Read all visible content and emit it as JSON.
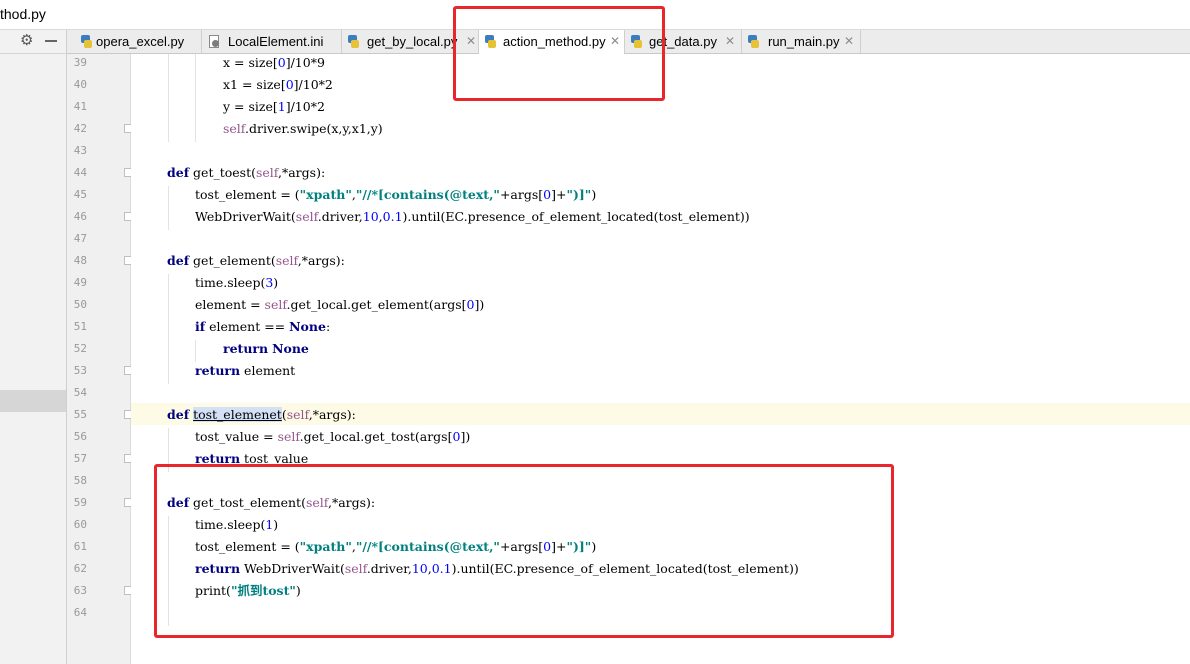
{
  "window": {
    "title": "thod.py"
  },
  "tabs": [
    {
      "label": "opera_excel.py",
      "icon": "python-file-icon"
    },
    {
      "label": "LocalElement.ini",
      "icon": "ini-file-icon"
    },
    {
      "label": "get_by_local.py",
      "icon": "python-file-icon"
    },
    {
      "label": "action_method.py",
      "icon": "python-file-icon",
      "active": true
    },
    {
      "label": "get_data.py",
      "icon": "python-file-icon"
    },
    {
      "label": "run_main.py",
      "icon": "python-file-icon"
    }
  ],
  "line_numbers": [
    "39",
    "40",
    "41",
    "42",
    "43",
    "44",
    "45",
    "46",
    "47",
    "48",
    "49",
    "50",
    "51",
    "52",
    "53",
    "54",
    "55",
    "56",
    "57",
    "58",
    "59",
    "60",
    "61",
    "62",
    "63",
    "64"
  ],
  "colors": {
    "keyword": "#000080",
    "self": "#94558d",
    "number": "#0000ff",
    "string": "#008080",
    "annotation": "#e8262b",
    "current_line": "#fdfbe6"
  },
  "code": {
    "l39": {
      "a": "x = size[",
      "b": "0",
      "c": "]/10*9"
    },
    "l40": {
      "a": "x1 = size[",
      "b": "0",
      "c": "]/10*2"
    },
    "l41": {
      "a": "y = size[",
      "b": "1",
      "c": "]/10*2"
    },
    "l42": {
      "self": "self",
      "rest": ".driver.swipe(x,y,x1,y)"
    },
    "l44": {
      "kw": "def",
      "name": " get_toest(",
      "self": "self",
      "rest": ",*args):"
    },
    "l45": {
      "a": "tost_element = (",
      "s1": "\"xpath\"",
      "b": ",",
      "s2": "\"//*[contains(@text,\"",
      "c": "+args[",
      "n": "0",
      "d": "]+",
      "s3": "\")]\"",
      "e": ")"
    },
    "l46": {
      "a": "WebDriverWait(",
      "self": "self",
      "b": ".driver,",
      "n1": "10",
      "c": ",",
      "n2": "0.1",
      "d": ").until(EC.presence_of_element_located(tost_element))"
    },
    "l48": {
      "kw": "def",
      "name": " get_element(",
      "self": "self",
      "rest": ",*args):"
    },
    "l49": {
      "a": "time.sleep(",
      "n": "3",
      "b": ")"
    },
    "l50": {
      "a": "element = ",
      "self": "self",
      "b": ".get_local.get_element(args[",
      "n": "0",
      "c": "])"
    },
    "l51": {
      "kw": "if",
      "a": " element == ",
      "kw2": "None",
      "b": ":"
    },
    "l52": {
      "kw": "return",
      "kw2": "None"
    },
    "l53": {
      "kw": "return",
      "rest": " element"
    },
    "l55": {
      "kw": "def",
      "name": "tost_elemenet",
      "self": "self",
      "rest": ",*args):"
    },
    "l56": {
      "a": "tost_value = ",
      "self": "self",
      "b": ".get_local.get_tost(args[",
      "n": "0",
      "c": "])"
    },
    "l57": {
      "kw": "return",
      "rest": " tost_value"
    },
    "l59": {
      "kw": "def",
      "name": " get_tost_element(",
      "self": "self",
      "rest": ",*args):"
    },
    "l60": {
      "a": "time.sleep(",
      "n": "1",
      "b": ")"
    },
    "l61": {
      "a": "tost_element = (",
      "s1": "\"xpath\"",
      "b": ",",
      "s2": "\"//*[contains(@text,\"",
      "c": "+args[",
      "n": "0",
      "d": "]+",
      "s3": "\")]\"",
      "e": ")"
    },
    "l62": {
      "kw": "return",
      "a": " WebDriverWait(",
      "self": "self",
      "b": ".driver,",
      "n1": "10",
      "c": ",",
      "n2": "0.1",
      "d": ").until(EC.presence_of_element_located(tost_element))"
    },
    "l63": {
      "a": "print(",
      "s": "\"抓到tost\"",
      "b": ")"
    }
  }
}
